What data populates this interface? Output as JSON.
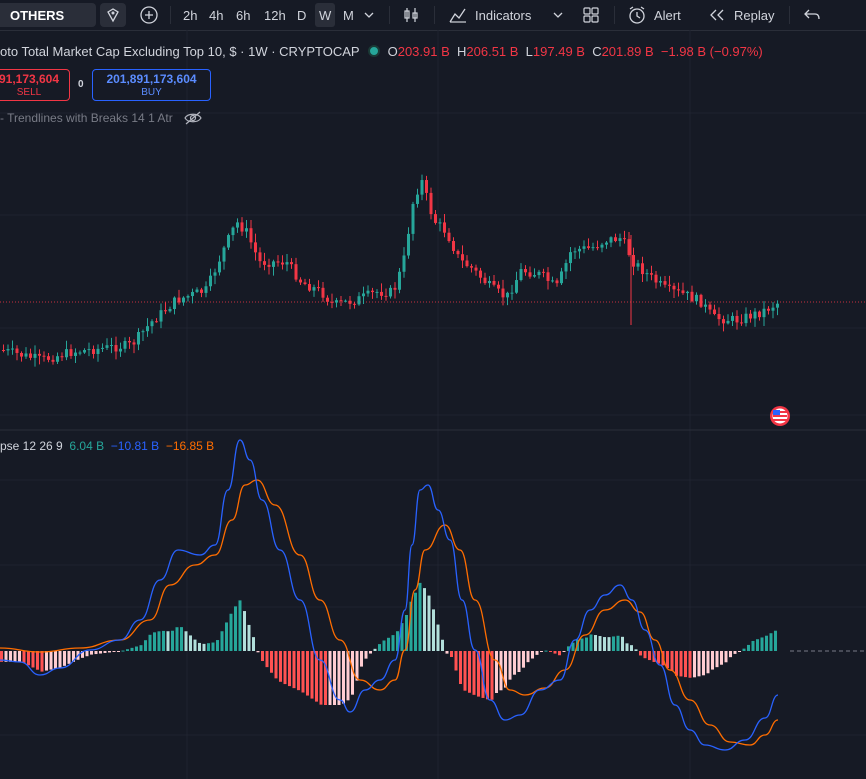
{
  "toolbar": {
    "symbol": "OTHERS",
    "resolutions": [
      "2h",
      "4h",
      "6h",
      "12h",
      "D",
      "W",
      "M"
    ],
    "active_resolution": "W",
    "indicators_label": "Indicators",
    "alert_label": "Alert",
    "replay_label": "Replay"
  },
  "legend": {
    "title": "oto Total Market Cap Excluding Top 10, $ · 1W · CRYPTOCAP",
    "open_label": "O",
    "open": "203.91 B",
    "high_label": "H",
    "high": "206.51 B",
    "low_label": "L",
    "low": "197.49 B",
    "close_label": "C",
    "close": "201.89 B",
    "change": "−1.98 B (−0.97%)"
  },
  "trade": {
    "sell_value": "91,173,604",
    "sell_label": "SELL",
    "spread": "0",
    "buy_value": "201,891,173,604",
    "buy_label": "BUY"
  },
  "indicator_line": "- Trendlines with Breaks 14 1 Atr",
  "macd": {
    "name": "pse 12 26 9",
    "hist": "6.04 B",
    "macd": "−10.81 B",
    "signal": "−16.85 B"
  },
  "colors": {
    "up": "#26a69a",
    "down": "#f23645",
    "macd_line": "#2962ff",
    "signal_line": "#ff6d00",
    "hist_up_strong": "#26a69a",
    "hist_up_weak": "#b2dfdb",
    "hist_down_strong": "#ff5252",
    "hist_down_weak": "#ffcdd2"
  },
  "icons": [
    "compare-icon",
    "add-symbol-icon",
    "chevron-down-icon",
    "candles-icon",
    "indicators-icon",
    "templates-icon",
    "alert-icon",
    "replay-icon",
    "undo-icon",
    "flag-us-icon",
    "eye-off-icon"
  ]
}
